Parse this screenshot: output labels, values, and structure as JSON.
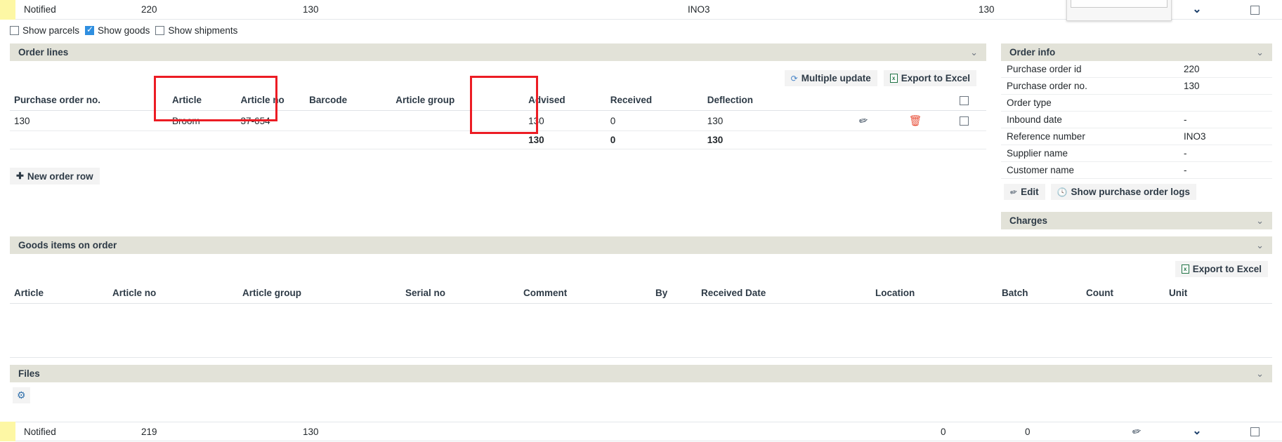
{
  "theme": {
    "section_header_bg": "#e2e2d8",
    "row_flag_color": "#fdf7a4",
    "annotation_color": "#ec1c24",
    "link_blue": "#1b3f6b",
    "delete_red": "#e8503a",
    "excel_green": "#1f7244"
  },
  "grid_rows": {
    "top": {
      "status": "Notified",
      "id": "220",
      "order_no": "130",
      "reference": "INO3",
      "value": "130",
      "pencil_icon": "pencil-icon",
      "chevron_icon": "chevron-down-icon",
      "checkbox_checked": false
    },
    "bottom": {
      "status": "Notified",
      "id": "219",
      "order_no": "130",
      "advised": "0",
      "received": "0",
      "pencil_icon": "pencil-icon",
      "chevron_icon": "chevron-down-icon",
      "checkbox_checked": false
    }
  },
  "popup": {
    "input_value": "",
    "input_placeholder": ""
  },
  "filters": [
    {
      "label": "Show parcels",
      "checked": false,
      "name": "show-parcels"
    },
    {
      "label": "Show goods",
      "checked": true,
      "name": "show-goods"
    },
    {
      "label": "Show shipments",
      "checked": false,
      "name": "show-shipments"
    }
  ],
  "order_lines": {
    "title": "Order lines",
    "collapse_icon": "chevron-down-icon",
    "buttons": {
      "multiple_update": "Multiple update",
      "export_to_excel": "Export to Excel",
      "multiple_update_icon": "refresh-icon",
      "export_icon": "excel-icon"
    },
    "columns": [
      "Purchase order no.",
      "Article",
      "Article no",
      "Barcode",
      "Article group",
      "Advised",
      "Received",
      "Deflection"
    ],
    "rows": [
      {
        "purchase_order_no": "130",
        "article": "Broom",
        "article_no": "37-654",
        "barcode": "",
        "article_group": "",
        "advised": "130",
        "received": "0",
        "deflection": "130",
        "edit_icon": "pencil-icon",
        "delete_icon": "trash-icon",
        "selected": false
      }
    ],
    "summary": {
      "advised": "130",
      "received": "0",
      "deflection": "130"
    },
    "new_order_row": "New order row",
    "new_order_row_icon": "plus-icon"
  },
  "goods_items": {
    "title": "Goods items on order",
    "collapse_icon": "chevron-down-icon",
    "export_to_excel": "Export to Excel",
    "export_icon": "excel-icon",
    "columns": [
      "Article",
      "Article no",
      "Article group",
      "Serial no",
      "Comment",
      "By",
      "Received Date",
      "Location",
      "Batch",
      "Count",
      "Unit"
    ],
    "rows": []
  },
  "files": {
    "title": "Files",
    "collapse_icon": "chevron-down-icon",
    "settings_icon": "gear-icon"
  },
  "order_info": {
    "title": "Order info",
    "collapse_icon": "chevron-down-icon",
    "fields": [
      {
        "label": "Purchase order id",
        "value": "220"
      },
      {
        "label": "Purchase order no.",
        "value": "130"
      },
      {
        "label": "Order type",
        "value": ""
      },
      {
        "label": "Inbound date",
        "value": "-"
      },
      {
        "label": "Reference number",
        "value": "INO3"
      },
      {
        "label": "Supplier name",
        "value": "-"
      },
      {
        "label": "Customer name",
        "value": "-"
      }
    ],
    "buttons": {
      "edit": "Edit",
      "edit_icon": "pencil-icon",
      "show_logs": "Show purchase order logs",
      "show_logs_icon": "clock-history-icon"
    }
  },
  "charges": {
    "title": "Charges",
    "collapse_icon": "chevron-down-icon"
  },
  "annotations": [
    {
      "name": "article-columns-highlight",
      "target": "Article / Article no columns"
    },
    {
      "name": "advised-column-highlight",
      "target": "Advised column"
    }
  ]
}
